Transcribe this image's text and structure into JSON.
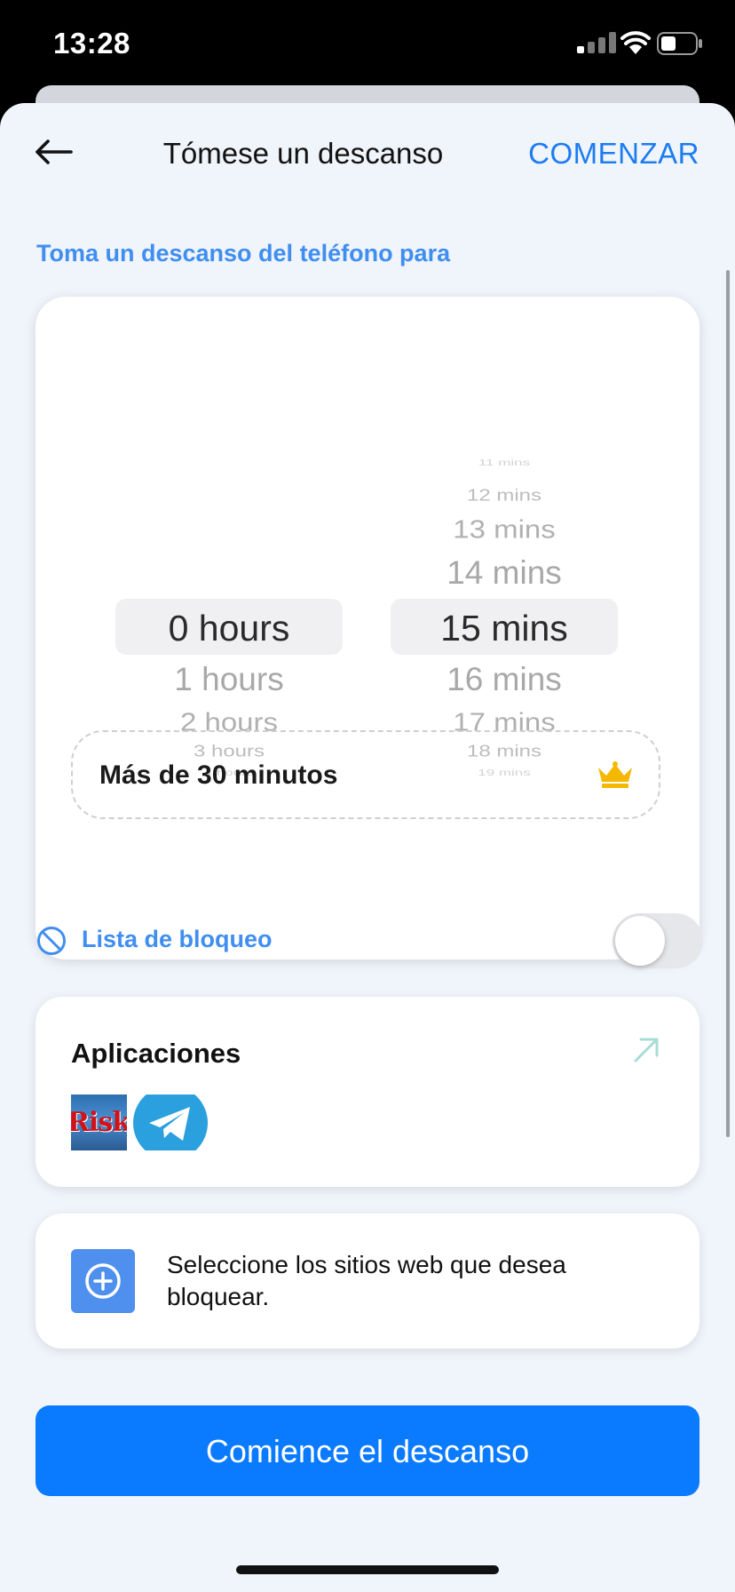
{
  "status_bar": {
    "time": "13:28"
  },
  "header": {
    "title": "Tómese un descanso",
    "start_label": "COMENZAR"
  },
  "duration": {
    "section_label": "Toma un descanso del teléfono para",
    "hours": [
      "0 hours",
      "1 hours",
      "2 hours",
      "3 hours",
      "4 hours"
    ],
    "selected_hours": "0 hours",
    "minutes": [
      "11 mins",
      "12 mins",
      "13 mins",
      "14 mins",
      "15 mins",
      "16 mins",
      "17 mins",
      "18 mins",
      "19 mins"
    ],
    "selected_minutes": "15 mins",
    "premium_option": "Más de 30 minutos",
    "premium_icon": "crown-icon"
  },
  "blocklist": {
    "label": "Lista de bloqueo",
    "icon": "block-icon",
    "enabled": false,
    "apps_title": "Aplicaciones",
    "apps": [
      {
        "name": "Risk",
        "icon_text": "Risk"
      },
      {
        "name": "Telegram",
        "icon": "telegram-icon"
      }
    ],
    "websites_prompt": "Seleccione los sitios web que desea bloquear."
  },
  "primary_action": {
    "label": "Comience el descanso"
  },
  "colors": {
    "accent": "#1c7cf0",
    "section_label": "#3f8ef0",
    "button": "#0a7aff",
    "background": "#f0f4fb",
    "crown": "#f5b800"
  }
}
